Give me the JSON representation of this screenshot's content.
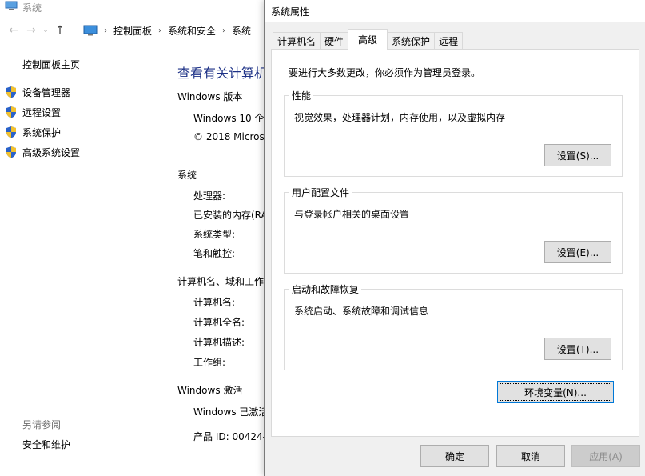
{
  "background": {
    "window_title": "系统",
    "breadcrumb": [
      "控制面板",
      "系统和安全",
      "系统"
    ],
    "left_nav": {
      "home": "控制面板主页",
      "links": [
        "设备管理器",
        "远程设置",
        "系统保护",
        "高级系统设置"
      ],
      "see_also": "另请参阅",
      "security": "安全和维护"
    },
    "main": {
      "title": "查看有关计算机",
      "windows_edition_head": "Windows 版本",
      "edition": "Windows 10 企",
      "copyright": "© 2018 Micros",
      "system_head": "系统",
      "processor": "处理器:",
      "ram": "已安装的内存(RA",
      "system_type": "系统类型:",
      "pen_touch": "笔和触控:",
      "name_head": "计算机名、域和工作",
      "computer_name": "计算机名:",
      "full_name": "计算机全名:",
      "description": "计算机描述:",
      "workgroup": "工作组:",
      "activation_head": "Windows 激活",
      "activated": "Windows 已激活",
      "product_id": "产品 ID: 00424-"
    }
  },
  "dialog": {
    "title": "系统属性",
    "tabs": [
      "计算机名",
      "硬件",
      "高级",
      "系统保护",
      "远程"
    ],
    "active_tab": "高级",
    "notice": "要进行大多数更改，你必须作为管理员登录。",
    "groups": [
      {
        "label": "性能",
        "desc": "视觉效果，处理器计划，内存使用，以及虚拟内存",
        "button": "设置(S)..."
      },
      {
        "label": "用户配置文件",
        "desc": "与登录帐户相关的桌面设置",
        "button": "设置(E)..."
      },
      {
        "label": "启动和故障恢复",
        "desc": "系统启动、系统故障和调试信息",
        "button": "设置(T)..."
      }
    ],
    "env_button": "环境变量(N)...",
    "footer": {
      "ok": "确定",
      "cancel": "取消",
      "apply": "应用(A)"
    }
  }
}
